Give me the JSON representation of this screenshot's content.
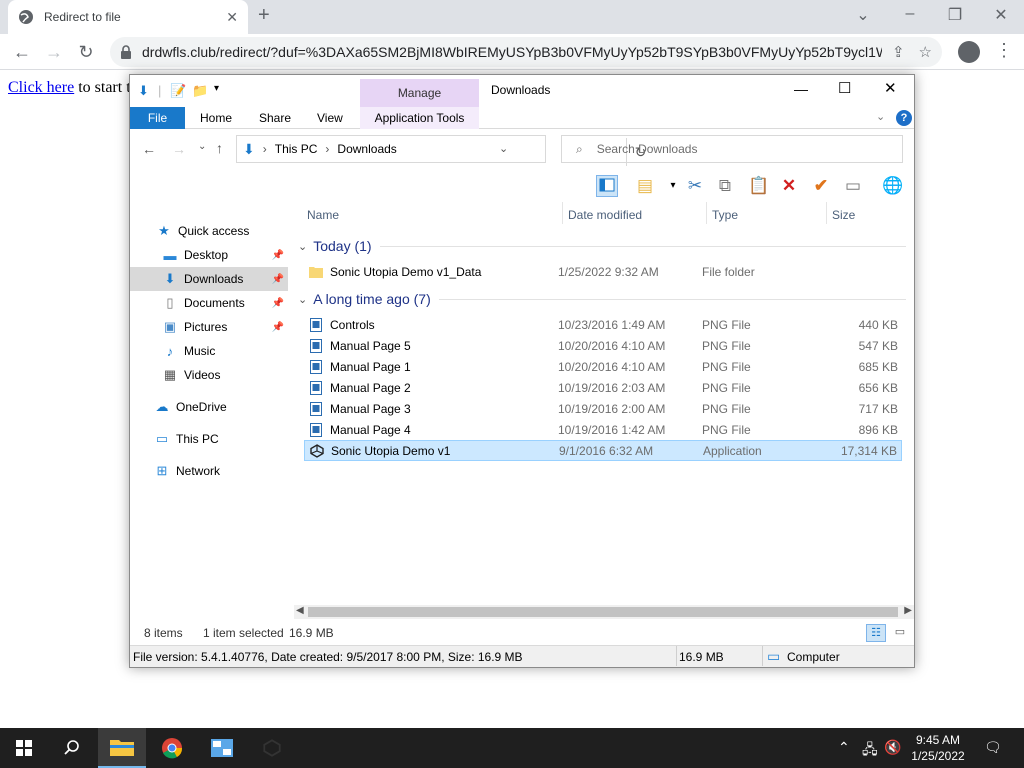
{
  "browser": {
    "tab_title": "Redirect to file",
    "url": "drdwfls.club/redirect/?duf=%3DAXa65SM2BjMI8WbIREMyUSYpB3b0VFMyUyYp52bT9SYpB3b0VFMyUyYp52bT9ycl1W..."
  },
  "page": {
    "link_text": "Click here",
    "after_text": "to start t"
  },
  "explorer": {
    "window_title": "Downloads",
    "manage_label": "Manage",
    "tabs": {
      "file": "File",
      "home": "Home",
      "share": "Share",
      "view": "View",
      "app_tools": "Application Tools"
    },
    "breadcrumb": [
      "This PC",
      "Downloads"
    ],
    "search_placeholder": "Search Downloads",
    "columns": {
      "name": "Name",
      "date": "Date modified",
      "type": "Type",
      "size": "Size"
    },
    "nav": {
      "quick_access": "Quick access",
      "desktop": "Desktop",
      "downloads": "Downloads",
      "documents": "Documents",
      "pictures": "Pictures",
      "music": "Music",
      "videos": "Videos",
      "onedrive": "OneDrive",
      "thispc": "This PC",
      "network": "Network"
    },
    "groups": {
      "today": "Today (1)",
      "longago": "A long time ago (7)"
    },
    "files": [
      {
        "name": "Sonic Utopia Demo v1_Data",
        "date": "1/25/2022 9:32 AM",
        "type": "File folder",
        "size": ""
      },
      {
        "name": "Controls",
        "date": "10/23/2016 1:49 AM",
        "type": "PNG File",
        "size": "440 KB"
      },
      {
        "name": "Manual Page 5",
        "date": "10/20/2016 4:10 AM",
        "type": "PNG File",
        "size": "547 KB"
      },
      {
        "name": "Manual Page 1",
        "date": "10/20/2016 4:10 AM",
        "type": "PNG File",
        "size": "685 KB"
      },
      {
        "name": "Manual Page 2",
        "date": "10/19/2016 2:03 AM",
        "type": "PNG File",
        "size": "656 KB"
      },
      {
        "name": "Manual Page 3",
        "date": "10/19/2016 2:00 AM",
        "type": "PNG File",
        "size": "717 KB"
      },
      {
        "name": "Manual Page 4",
        "date": "10/19/2016 1:42 AM",
        "type": "PNG File",
        "size": "896 KB"
      },
      {
        "name": "Sonic Utopia Demo v1",
        "date": "9/1/2016 6:32 AM",
        "type": "Application",
        "size": "17,314 KB"
      }
    ],
    "status": {
      "items": "8 items",
      "selected": "1 item selected",
      "size": "16.9 MB"
    },
    "details": {
      "info": "File version: 5.4.1.40776, Date created: 9/5/2017 8:00 PM, Size: 16.9 MB",
      "size": "16.9 MB",
      "location": "Computer"
    }
  },
  "taskbar": {
    "time": "9:45 AM",
    "date": "1/25/2022"
  },
  "colors": {
    "accent": "#1979ca",
    "selection": "#cce8ff",
    "manage": "#e7d5f5"
  }
}
